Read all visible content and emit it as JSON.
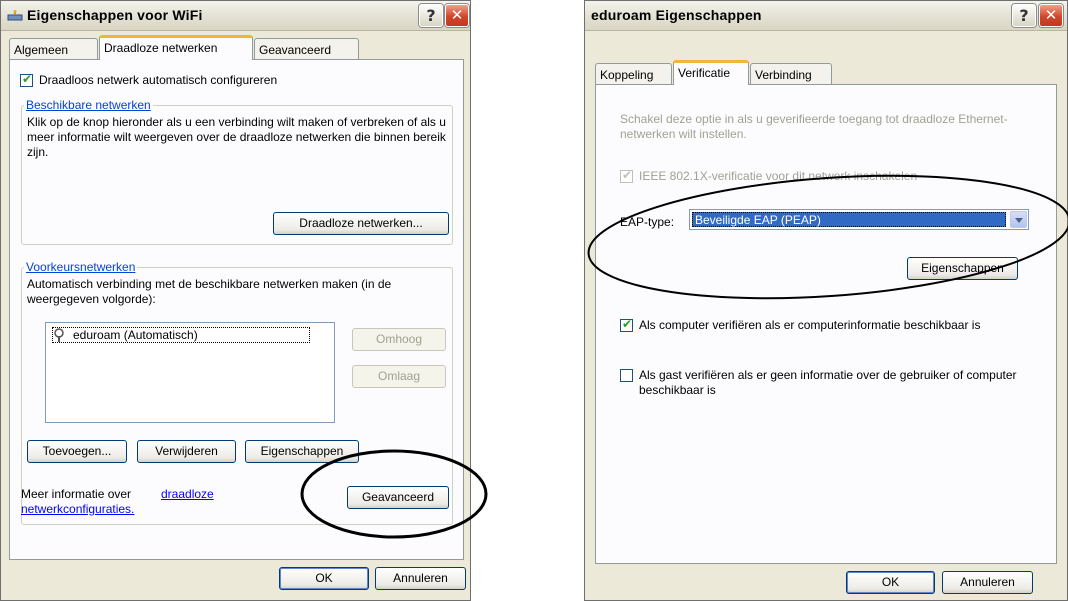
{
  "left_dialog": {
    "title": "Eigenschappen voor WiFi",
    "tabs": [
      "Algemeen",
      "Draadloze netwerken",
      "Geavanceerd"
    ],
    "auto_config_label": "Draadloos netwerk automatisch configureren",
    "available": {
      "legend": "Beschikbare netwerken",
      "description": "Klik op de knop hieronder als u een verbinding wilt maken of verbreken of als u meer informatie wilt weergeven over de draadloze netwerken die binnen bereik zijn.",
      "button": "Draadloze netwerken..."
    },
    "preferred": {
      "legend": "Voorkeursnetwerken",
      "description": "Automatisch verbinding met de beschikbare netwerken maken (in de weergegeven volgorde):",
      "items": [
        "eduroam (Automatisch)"
      ],
      "up_button": "Omhoog",
      "down_button": "Omlaag",
      "add_button": "Toevoegen...",
      "remove_button": "Verwijderen",
      "properties_button": "Eigenschappen"
    },
    "more_info_prefix": "Meer informatie over ",
    "more_info_link": "draadloze netwerkconfiguraties.",
    "advanced_button": "Geavanceerd",
    "ok_button": "OK",
    "cancel_button": "Annuleren"
  },
  "right_dialog": {
    "title": "eduroam Eigenschappen",
    "tabs": [
      "Koppeling",
      "Verificatie",
      "Verbinding"
    ],
    "intro": "Schakel deze optie in als u geverifieerde toegang tot draadloze Ethernet-netwerken wilt instellen.",
    "ieee_label": "IEEE 802.1X-verificatie voor dit netwerk inschakelen",
    "eap_label": "EAP-type:",
    "eap_value": "Beveiligde EAP (PEAP)",
    "properties_button": "Eigenschappen",
    "computer_auth_label": "Als computer verifiëren als er computerinformatie beschikbaar is",
    "guest_auth_label": "Als gast verifiëren als er geen informatie over de gebruiker of computer beschikbaar is",
    "ok_button": "OK",
    "cancel_button": "Annuleren"
  }
}
